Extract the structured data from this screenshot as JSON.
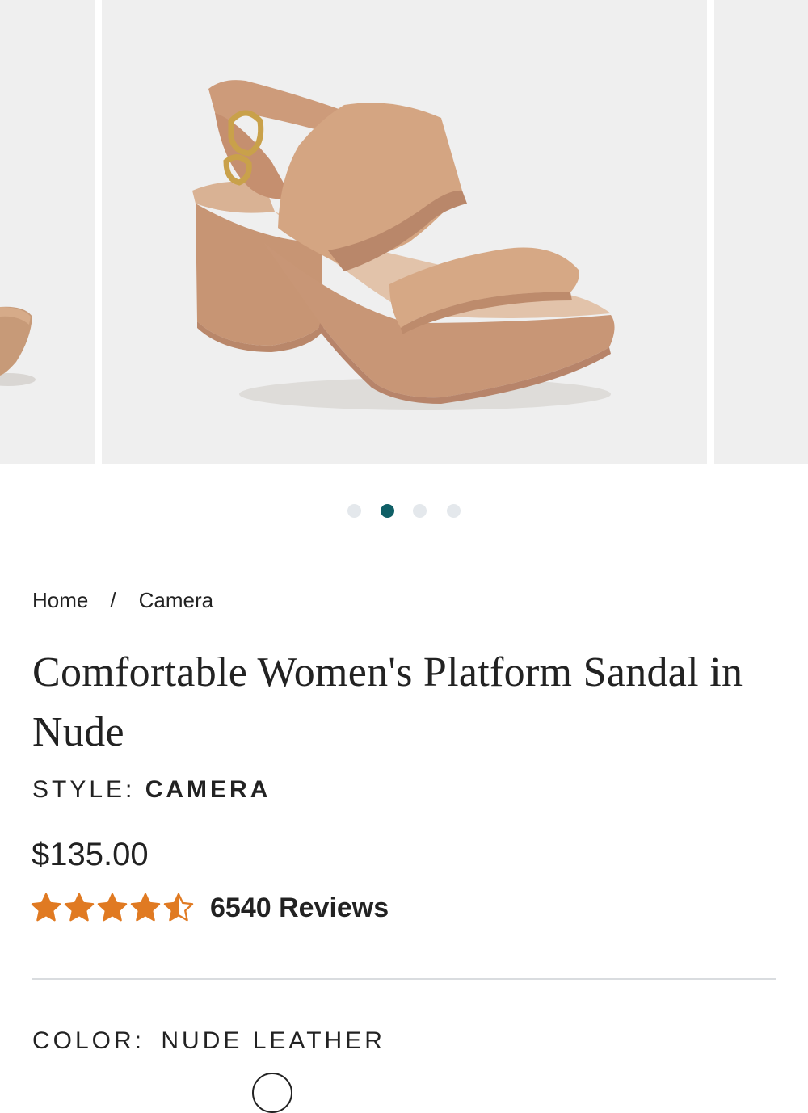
{
  "carousel": {
    "slide_count": 4,
    "active_index": 1,
    "accent_color": "#0f5f66",
    "inactive_dot_color": "#e4e8ec",
    "zoom_icon": "search-icon"
  },
  "breadcrumb": {
    "items": [
      {
        "label": "Home"
      },
      {
        "label": "Camera"
      }
    ],
    "separator": "/"
  },
  "product": {
    "title": "Comfortable Women's Platform Sandal in Nude",
    "style_label": "STYLE:",
    "style_value": "CAMERA",
    "price": "$135.00",
    "rating": 4.5,
    "rating_max": 5,
    "star_color": "#e07a22",
    "reviews_text": "6540 Reviews",
    "color_label": "COLOR:",
    "color_value": "NUDE LEATHER"
  }
}
